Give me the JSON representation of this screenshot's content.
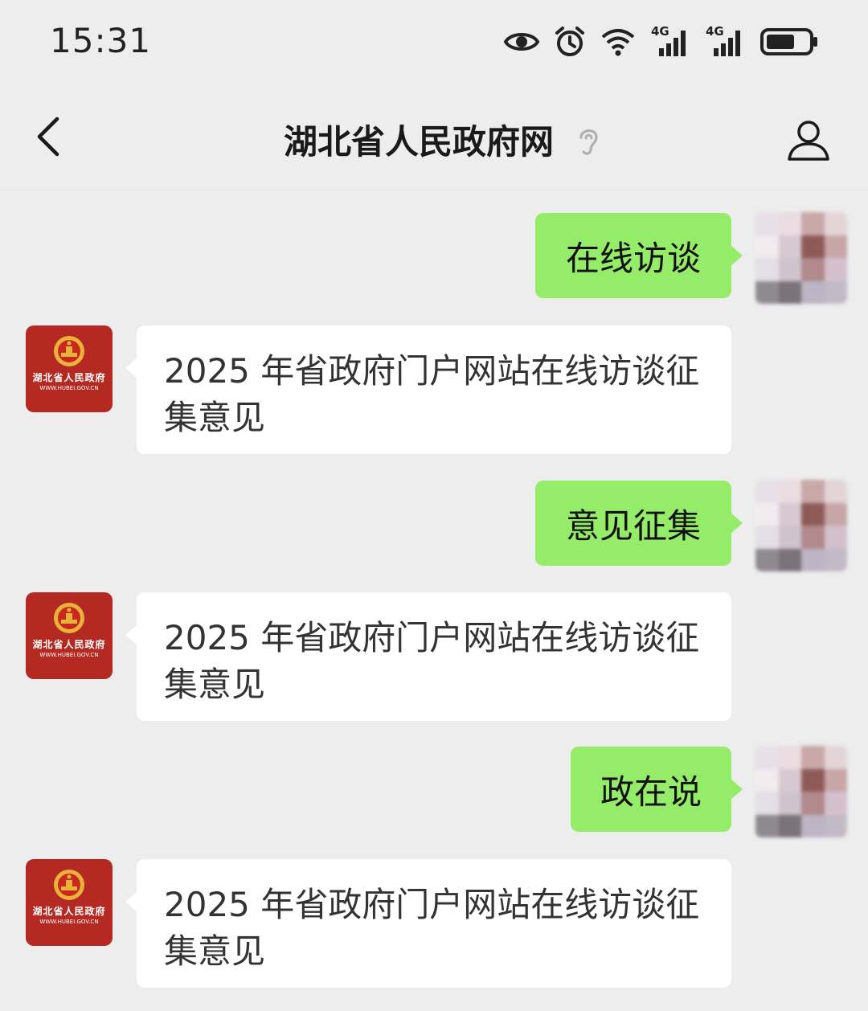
{
  "status_bar": {
    "time": "15:31",
    "icons": [
      "eye-icon",
      "alarm-icon",
      "wifi-icon",
      "signal-4g-icon",
      "signal-4g-icon",
      "battery-icon"
    ],
    "network_labels": [
      "4G",
      "4G"
    ]
  },
  "header": {
    "title": "湖北省人民政府网",
    "back_icon": "chevron-left-icon",
    "listen_icon": "ear-icon",
    "profile_icon": "person-icon"
  },
  "gov_avatar": {
    "name": "湖北省人民政府",
    "url": "WWW.HUBEI.GOV.CN",
    "color": "#b42a22"
  },
  "colors": {
    "outgoing_bubble": "#95ec69",
    "incoming_bubble": "#ffffff",
    "background": "#ededed"
  },
  "messages": [
    {
      "direction": "outgoing",
      "text": "在线访谈"
    },
    {
      "direction": "incoming",
      "text": "2025 年省政府门户网站在线访谈征集意见"
    },
    {
      "direction": "outgoing",
      "text": "意见征集"
    },
    {
      "direction": "incoming",
      "text": "2025 年省政府门户网站在线访谈征集意见"
    },
    {
      "direction": "outgoing",
      "text": "政在说"
    },
    {
      "direction": "incoming",
      "text": "2025 年省政府门户网站在线访谈征集意见"
    }
  ]
}
